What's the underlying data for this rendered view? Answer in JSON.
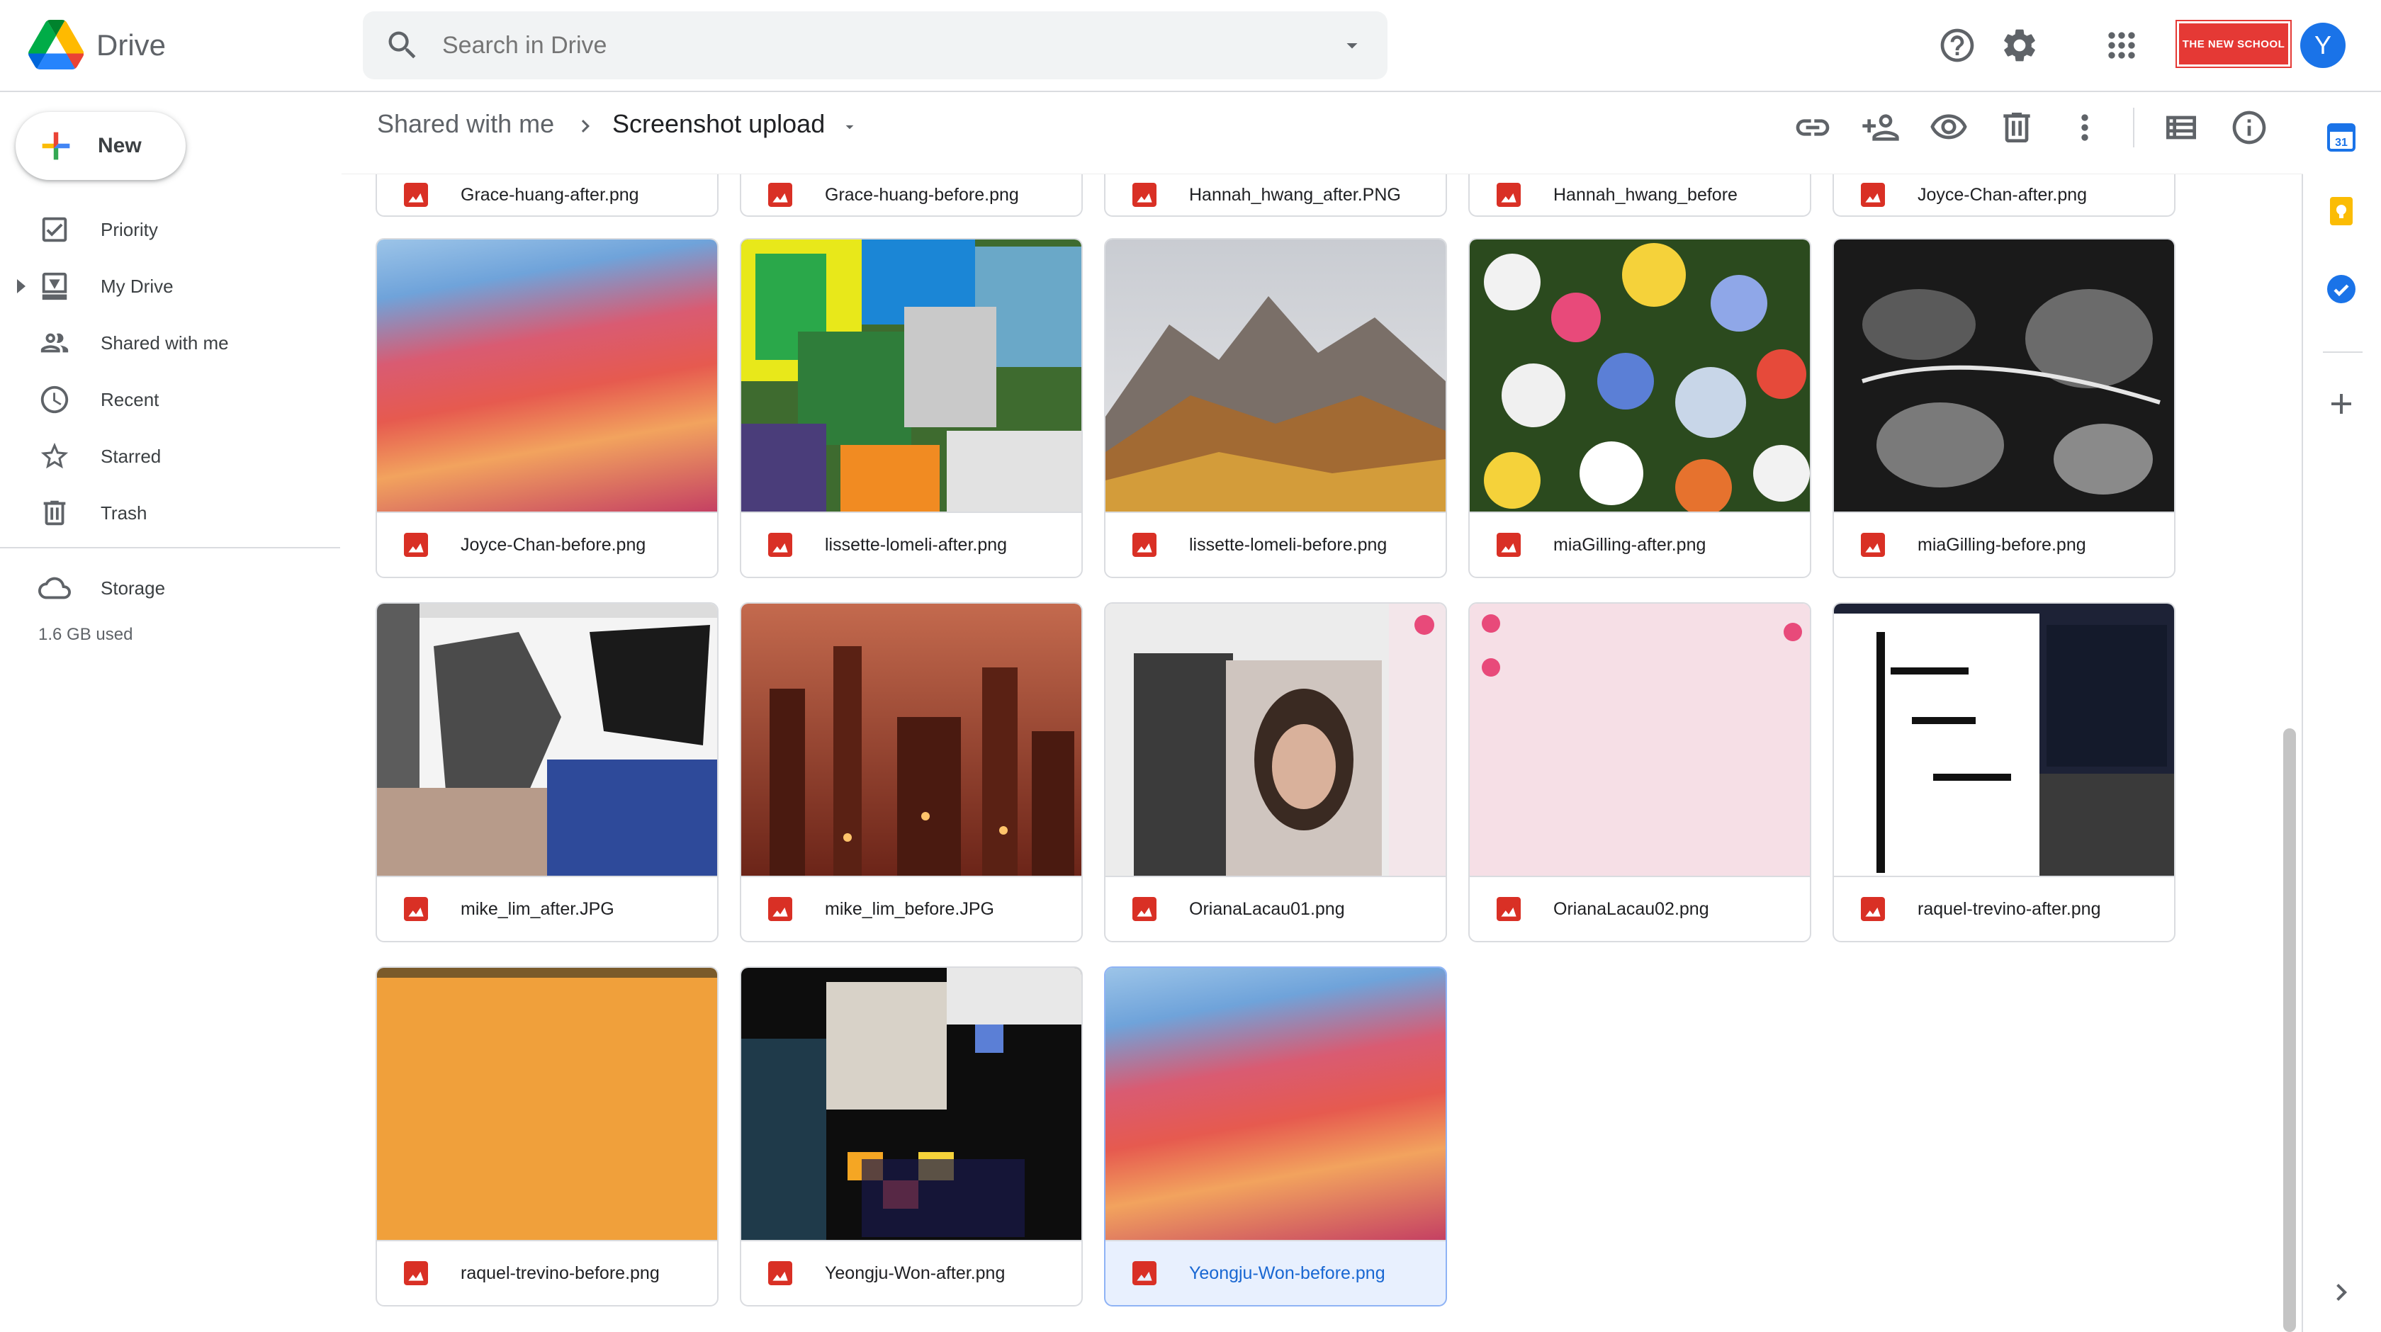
{
  "app": {
    "name": "Drive"
  },
  "search": {
    "placeholder": "Search in Drive"
  },
  "header": {
    "org_logo_text": "THE NEW SCHOOL",
    "avatar_initial": "Y"
  },
  "sidebar": {
    "new_label": "New",
    "items": [
      {
        "label": "Priority",
        "icon": "priority-icon"
      },
      {
        "label": "My Drive",
        "icon": "my-drive-icon"
      },
      {
        "label": "Shared with me",
        "icon": "shared-icon"
      },
      {
        "label": "Recent",
        "icon": "recent-icon"
      },
      {
        "label": "Starred",
        "icon": "star-icon"
      },
      {
        "label": "Trash",
        "icon": "trash-icon"
      }
    ],
    "storage_label": "Storage",
    "storage_used": "1.6 GB used"
  },
  "breadcrumb": {
    "root": "Shared with me",
    "current": "Screenshot upload"
  },
  "files": [
    {
      "name": "Grace-huang-after.png"
    },
    {
      "name": "Grace-huang-before.png"
    },
    {
      "name": "Hannah_hwang_after.PNG"
    },
    {
      "name": "Hannah_hwang_before"
    },
    {
      "name": "Joyce-Chan-after.png"
    },
    {
      "name": "Joyce-Chan-before.png"
    },
    {
      "name": "lissette-lomeli-after.png"
    },
    {
      "name": "lissette-lomeli-before.png"
    },
    {
      "name": "miaGilling-after.png"
    },
    {
      "name": "miaGilling-before.png"
    },
    {
      "name": "mike_lim_after.JPG"
    },
    {
      "name": "mike_lim_before.JPG"
    },
    {
      "name": "OrianaLacau01.png"
    },
    {
      "name": "OrianaLacau02.png"
    },
    {
      "name": "raquel-trevino-after.png"
    },
    {
      "name": "raquel-trevino-before.png"
    },
    {
      "name": "Yeongju-Won-after.png"
    },
    {
      "name": "Yeongju-Won-before.png",
      "selected": true
    }
  ],
  "colors": {
    "accent": "#1a73e8",
    "file_icon": "#d93025",
    "selected_bg": "#e8f0fe"
  }
}
